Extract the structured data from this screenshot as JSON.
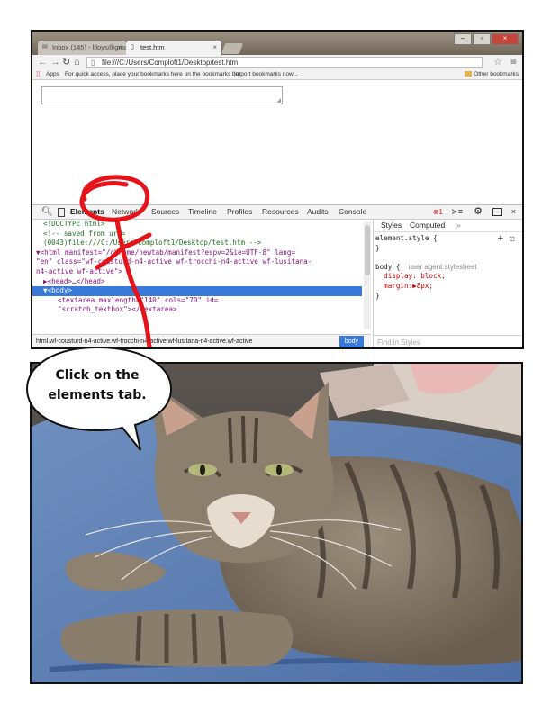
{
  "browser": {
    "tabs": [
      {
        "label": "Inbox (145) - lfloys@gma",
        "active": false
      },
      {
        "label": "test.htm",
        "active": true
      }
    ],
    "url": "file:///C:/Users/Comploft1/Desktop/test.htm",
    "bookmarks": {
      "apps": "Apps",
      "hint": "For quick access, place your bookmarks here on the bookmarks bar.",
      "import": "Import bookmarks now...",
      "other": "Other bookmarks"
    }
  },
  "devtools": {
    "tabs": [
      "Elements",
      "Network",
      "Sources",
      "Timeline",
      "Profiles",
      "Resources",
      "Audits",
      "Console"
    ],
    "active_tab": "Elements",
    "error_count": "1",
    "elements_lines": [
      {
        "indent": 1,
        "text": "<!DOCTYPE html>",
        "kind": "doctype"
      },
      {
        "indent": 1,
        "text": "<!-- saved from url=",
        "kind": "comment"
      },
      {
        "indent": 1,
        "text": "(0043)file:///C:/Users/Comploft1/Desktop/test.htm -->",
        "kind": "comment"
      },
      {
        "indent": 0,
        "text": "▼<html manifest=\"/chrome/newtab/manifest?espv=2&ie=UTF-8\" lang=",
        "kind": "tag"
      },
      {
        "indent": 0,
        "text": "\"en\" class=\"wf-cousturd-n4-active wf-trocchi-n4-active wf-lusitana-",
        "kind": "tag"
      },
      {
        "indent": 0,
        "text": "n4-active wf-active\">",
        "kind": "tag"
      },
      {
        "indent": 1,
        "text": "▶<head>…</head>",
        "kind": "tag"
      },
      {
        "indent": 1,
        "text": "▼<body>",
        "kind": "selected"
      },
      {
        "indent": 3,
        "text": "<textarea maxlength=\"140\" cols=\"70\" id=",
        "kind": "tag"
      },
      {
        "indent": 3,
        "text": "\"scratch_textbox\"></textarea>",
        "kind": "tag"
      }
    ],
    "breadcrumb": "html.wf-cousturd-n4-active.wf-trocchi-n4-active.wf-lusitana-n4-active.wf-active",
    "breadcrumb_current": "body",
    "styles": {
      "tabs": [
        "Styles",
        "Computed"
      ],
      "more": "»",
      "lines": [
        {
          "text": "element.style {",
          "kind": "plain"
        },
        {
          "text": "}",
          "kind": "plain"
        },
        {
          "text": "",
          "kind": "plain"
        },
        {
          "text": "body {  user agent stylesheet",
          "kind": "ua"
        },
        {
          "text": "  display: block;",
          "kind": "prop"
        },
        {
          "text": "  margin:▶8px;",
          "kind": "prop"
        },
        {
          "text": "}",
          "kind": "plain"
        }
      ],
      "find_placeholder": "Find in Styles"
    }
  },
  "caption": {
    "text": "Click on the elements tab."
  },
  "colors": {
    "annotation_red": "#e5141b",
    "selection_blue": "#3879d9"
  }
}
